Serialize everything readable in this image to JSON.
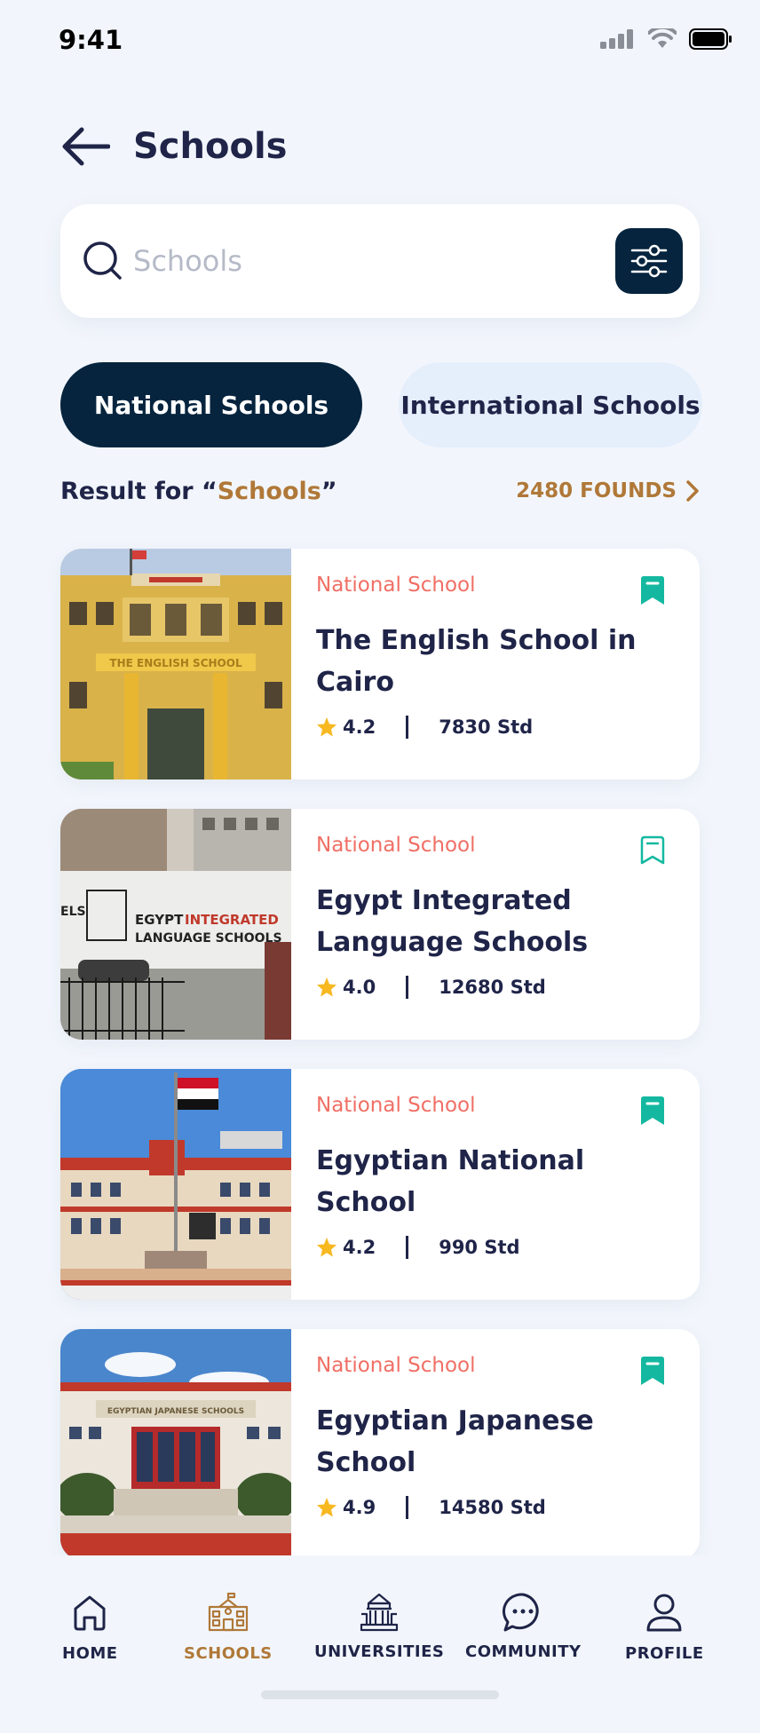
{
  "status_bar": {
    "time": "9:41"
  },
  "header": {
    "title": "Schools"
  },
  "search": {
    "placeholder": "Schools"
  },
  "tabs": [
    {
      "label": "National Schools",
      "active": true
    },
    {
      "label": "International Schools",
      "active": false
    }
  ],
  "results": {
    "prefix": "Result for “",
    "query": "Schools",
    "suffix": "”",
    "count_label": "2480 FOUNDS"
  },
  "schools": [
    {
      "category": "National School",
      "name": "The English School in Cairo",
      "rating": "4.2",
      "students": "7830 Std",
      "bookmarked": true
    },
    {
      "category": "National School",
      "name": "Egypt Integrated Language Schools",
      "rating": "4.0",
      "students": "12680 Std",
      "bookmarked": false
    },
    {
      "category": "National School",
      "name": "Egyptian National School",
      "rating": "4.2",
      "students": "990 Std",
      "bookmarked": true
    },
    {
      "category": "National School",
      "name": "Egyptian Japanese School",
      "rating": "4.9",
      "students": "14580 Std",
      "bookmarked": true
    }
  ],
  "nav": [
    {
      "label": "HOME",
      "icon": "home-icon",
      "active": false
    },
    {
      "label": "SCHOOLS",
      "icon": "school-icon",
      "active": true
    },
    {
      "label": "UNIVERSITIES",
      "icon": "university-icon",
      "active": false
    },
    {
      "label": "COMMUNITY",
      "icon": "chat-icon",
      "active": false
    },
    {
      "label": "PROFILE",
      "icon": "profile-icon",
      "active": false
    }
  ],
  "colors": {
    "primary_dark": "#06243e",
    "accent_brown": "#b07838",
    "category_red": "#f06f65",
    "bookmark_teal": "#14b8a0",
    "star_yellow": "#f8b820"
  }
}
